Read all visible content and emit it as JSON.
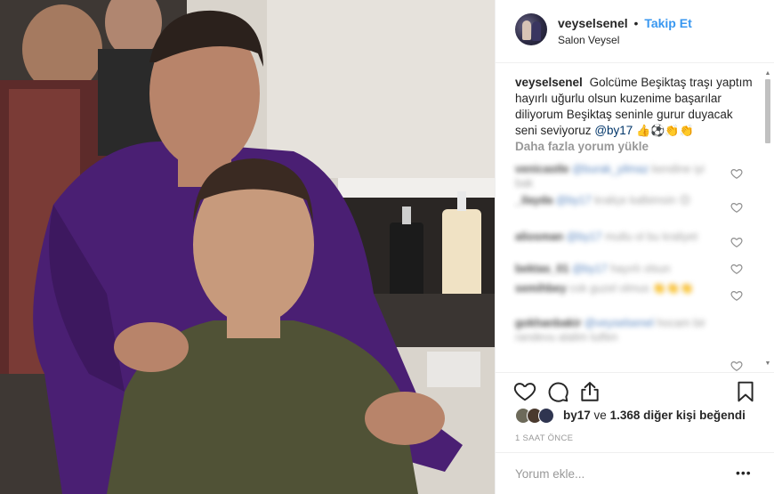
{
  "post": {
    "photo_alt": "Salon photo",
    "header": {
      "username": "veyselsenel",
      "separator": "•",
      "follow_label": "Takip Et",
      "location": "Salon Veysel"
    },
    "caption": {
      "username": "veyselsenel",
      "text": "Golcüme Beşiktaş traşı yaptım hayırlı uğurlu olsun kuzenime başarılar diliyorum Beşiktaş seninle gurur duyacak seni seviyoruz",
      "mention": "@by17",
      "emoji": "👍⚽👏👏"
    },
    "load_more_label": "Daha fazla yorum yükle",
    "comments": [
      {
        "user": "venicastle",
        "mention": "@burak_yilmaz",
        "text": "kendine iyi bak"
      },
      {
        "user": "_ilayda",
        "mention": "@by17",
        "text": "kraliçe kalbimsin 😊"
      },
      {
        "user": "aliosman",
        "mention": "@by17",
        "text": "mutlu ol bu kraliyet"
      },
      {
        "user": "bektas_01",
        "mention": "@by17",
        "text": "hayırlı olsun"
      },
      {
        "user": "semihbey",
        "mention": "",
        "text": "cok guzel olmus 👏👏👏"
      },
      {
        "user": "gokhanbakir",
        "mention": "@veyselsenel",
        "text": "hocam bir randevu alalim lutfen"
      }
    ],
    "likes": {
      "liker": "by17",
      "connector": "ve",
      "count": "1.368",
      "suffix": "diğer kişi beğendi"
    },
    "time_label": "1 SAAT ÖNCE",
    "comment_input_placeholder": "Yorum ekle...",
    "more_options_label": "•••",
    "icons": {
      "like": "heart-icon",
      "comment": "comment-bubble-icon",
      "share": "share-icon",
      "save": "bookmark-icon"
    },
    "colors": {
      "follow": "#3897f0",
      "mention": "#003569",
      "muted": "#999999",
      "text": "#262626"
    }
  }
}
